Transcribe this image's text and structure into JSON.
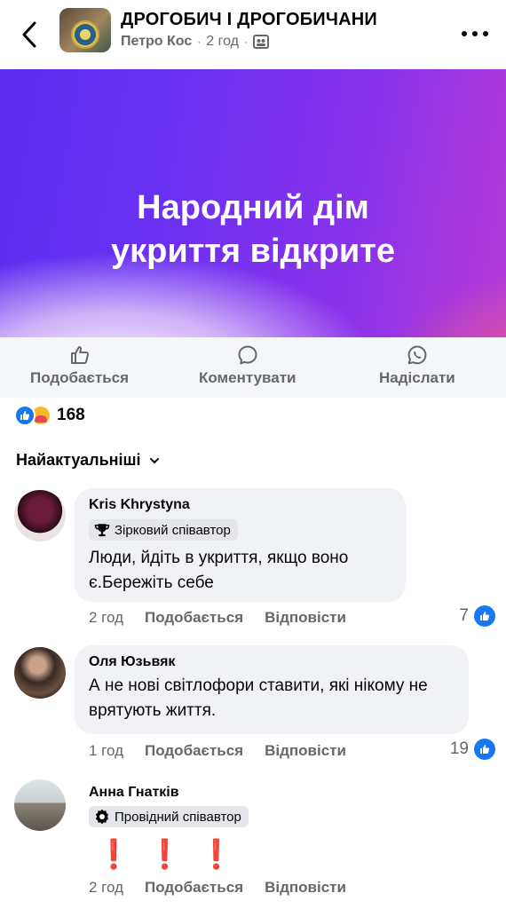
{
  "header": {
    "group_name": "ДРОГОБИЧ І ДРОГОБИЧАНИ",
    "author": "Петро Кос",
    "time": "2 год",
    "separator": "·",
    "privacy_icon": "group-members-icon"
  },
  "banner": {
    "title_line1": "Народний дім",
    "title_line2": "укриття відкрите"
  },
  "actions": {
    "like_label": "Подобається",
    "comment_label": "Коментувати",
    "send_label": "Надіслати"
  },
  "reactions": {
    "count": "168",
    "types": [
      "like",
      "care"
    ]
  },
  "sort": {
    "label": "Найактуальніші"
  },
  "comments": [
    {
      "name": "Kris Khrystyna",
      "badge": "Зірковий співавтор",
      "badge_icon": "trophy-icon",
      "text": "Люди, йдіть в укриття, якщо воно є.Бережіть себе",
      "time": "2 год",
      "like_label": "Подобається",
      "reply_label": "Відповісти",
      "likes": "7"
    },
    {
      "name": "Оля Юзьвяк",
      "text": "А не нові світлофори ставити, які нікому не врятують життя.",
      "time": "1 год",
      "like_label": "Подобається",
      "reply_label": "Відповісти",
      "likes": "19"
    },
    {
      "name": "Анна Гнатків",
      "badge": "Провідний співавтор",
      "badge_icon": "rosette-icon",
      "text": "❗❗❗",
      "time": "2 год",
      "like_label": "Подобається",
      "reply_label": "Відповісти"
    }
  ],
  "colors": {
    "brand_blue": "#1877f2",
    "secondary_text": "#65676b",
    "bubble_bg": "#f0f2f5",
    "exclamation_red": "#e41e3f"
  }
}
